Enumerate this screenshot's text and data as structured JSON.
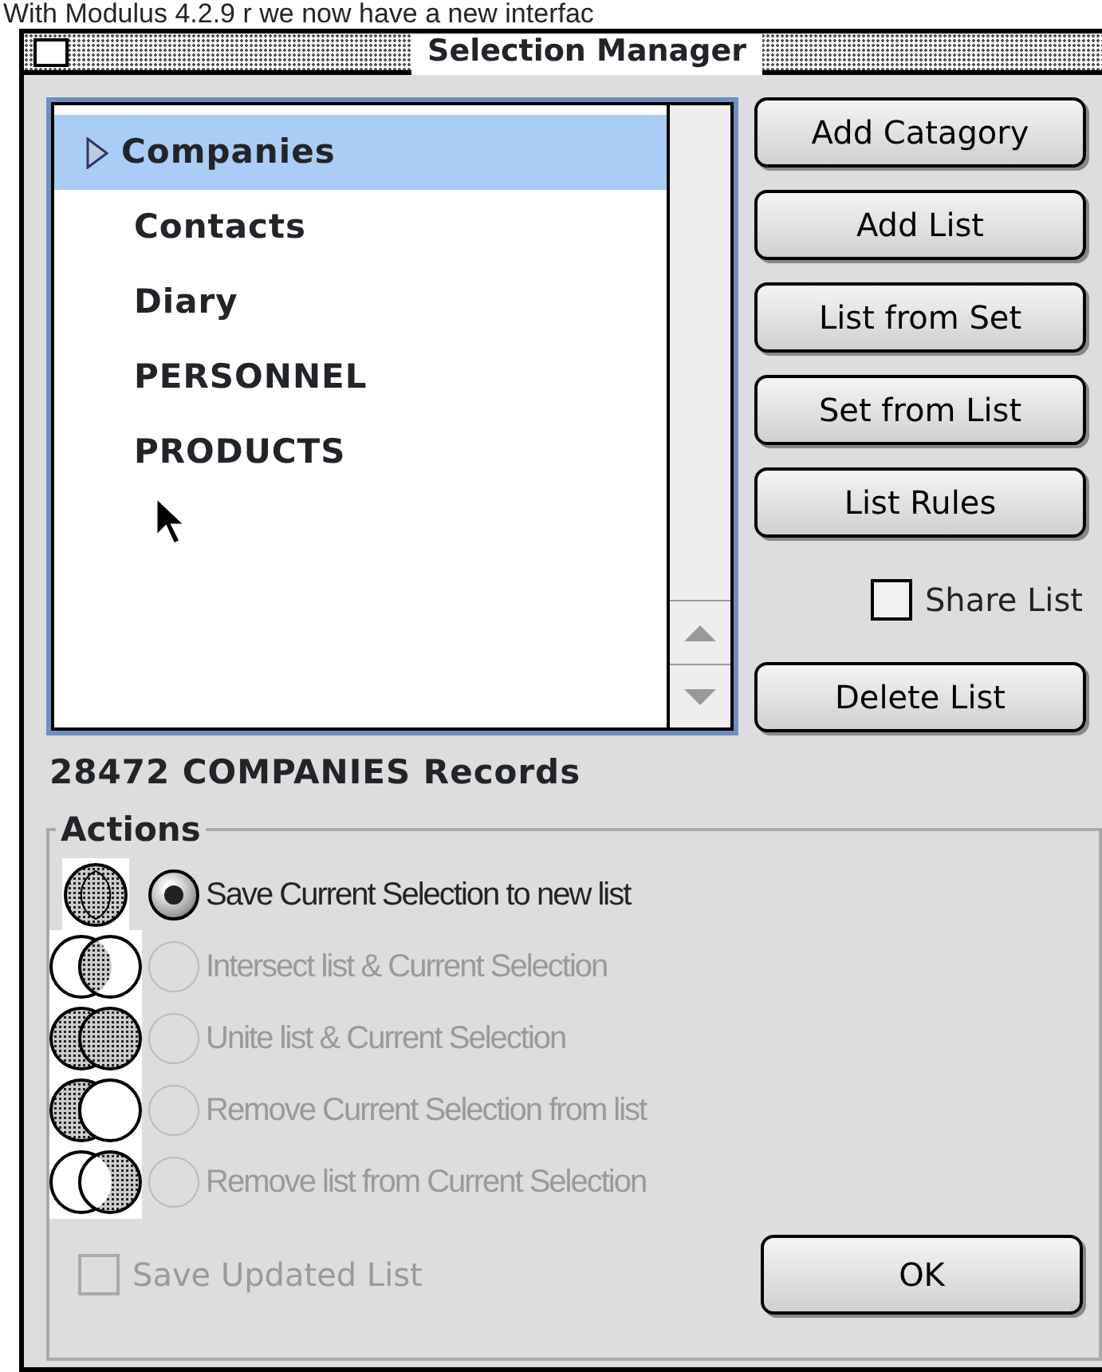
{
  "header_text": "With Modulus 4.2.9 r we now have a new interfac",
  "window": {
    "title": "Selection Manager"
  },
  "list": {
    "items": [
      {
        "label": "Companies",
        "selected": true
      },
      {
        "label": "Contacts",
        "selected": false
      },
      {
        "label": "Diary",
        "selected": false
      },
      {
        "label": "PERSONNEL",
        "selected": false
      },
      {
        "label": "PRODUCTS",
        "selected": false
      }
    ]
  },
  "buttons": [
    "Add Catagory",
    "Add List",
    "List from Set",
    "Set from List",
    "List Rules"
  ],
  "share_list": {
    "label": "Share List",
    "checked": false
  },
  "delete_button": "Delete List",
  "record_count": "28472 COMPANIES Records",
  "actions": {
    "title": "Actions",
    "options": [
      {
        "label": "Save Current Selection to new list",
        "kind": "new",
        "selected": true,
        "disabled": false
      },
      {
        "label": "Intersect list & Current Selection",
        "kind": "intersect",
        "selected": false,
        "disabled": true
      },
      {
        "label": "Unite list & Current Selection",
        "kind": "unite",
        "selected": false,
        "disabled": true
      },
      {
        "label": "Remove Current Selection from list",
        "kind": "remove-selection",
        "selected": false,
        "disabled": true
      },
      {
        "label": "Remove list from Current Selection",
        "kind": "remove-list",
        "selected": false,
        "disabled": true
      }
    ]
  },
  "save_updated": {
    "label": "Save Updated List",
    "checked": false,
    "disabled": true
  },
  "ok_button": "OK"
}
